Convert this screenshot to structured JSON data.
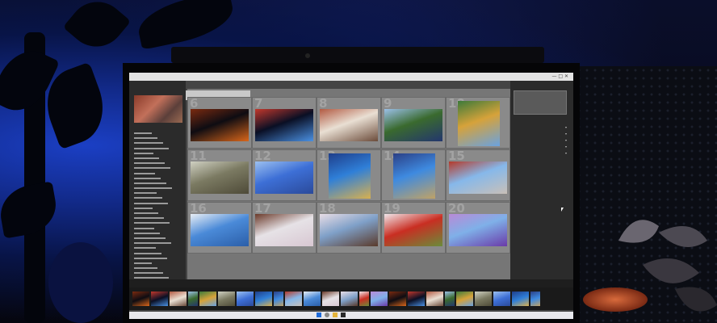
{
  "scene": {
    "description_colors": {
      "ambient": "#1b3fc4",
      "monitor_bezel": "#050507",
      "lightroom_panel": "#2b2b2b",
      "grid_bg": "#767676"
    }
  },
  "lightroom": {
    "grid_numbers": [
      "6",
      "7",
      "8",
      "9",
      "10",
      "11",
      "12",
      "13",
      "14",
      "15",
      "16",
      "17",
      "18",
      "19",
      "20"
    ],
    "window_controls": "— □ ✕"
  },
  "icons": [
    "minimize-icon",
    "maximize-icon",
    "close-icon",
    "windows-start-icon",
    "search-icon",
    "folder-icon"
  ]
}
